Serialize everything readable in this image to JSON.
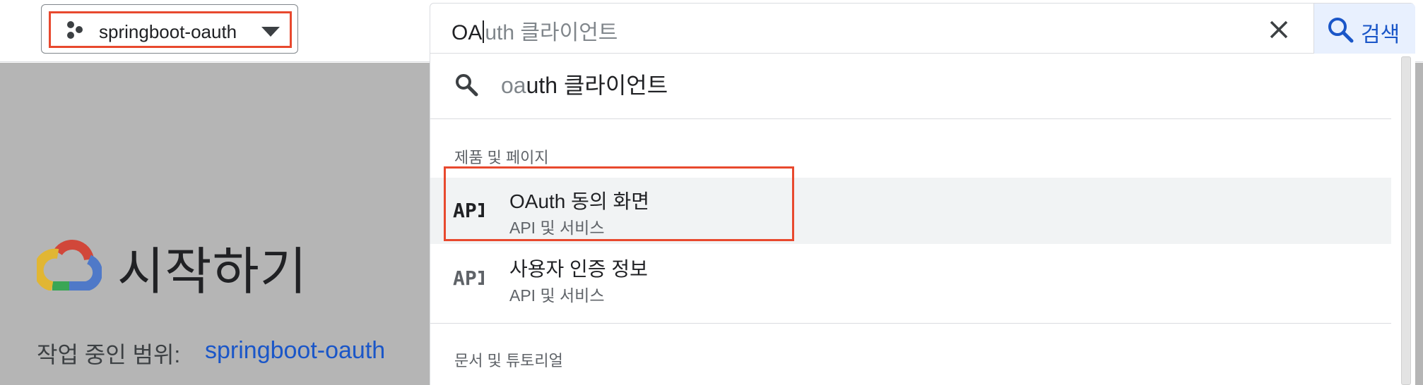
{
  "project_picker": {
    "name": "springboot-oauth",
    "icon": "hexagon-cluster-icon"
  },
  "page": {
    "title": "시작하기",
    "scope_label": "작업 중인 범위:",
    "scope_link": "springboot-oauth"
  },
  "search": {
    "typed": "OA",
    "autocomplete": "uth 클라이언트",
    "button_label": "검색"
  },
  "dropdown": {
    "suggestion": {
      "prefix": "oa",
      "rest": "uth 클라이언트"
    },
    "sections": [
      {
        "header": "제품 및 페이지",
        "results": [
          {
            "icon": "API",
            "title": "OAuth 동의 화면",
            "subtitle": "API 및 서비스",
            "highlighted": true
          },
          {
            "icon": "API",
            "title": "사용자 인증 정보",
            "subtitle": "API 및 서비스",
            "highlighted": false
          }
        ]
      },
      {
        "header": "문서 및 튜토리얼",
        "results": []
      }
    ]
  },
  "colors": {
    "annotation_red": "#e8492e",
    "link_blue": "#1a56c8",
    "backdrop_gray": "#b5b5b5",
    "highlight_gray": "#f1f3f4"
  }
}
